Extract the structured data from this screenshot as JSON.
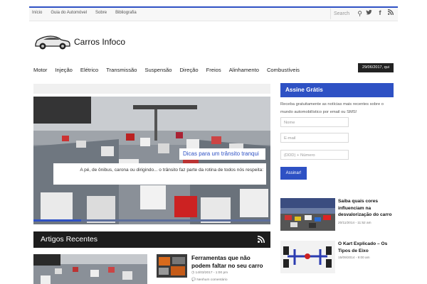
{
  "topnav": [
    "Início",
    "Guia do Automóvel",
    "Sobre",
    "Bibliografia"
  ],
  "search_placeholder": "Search",
  "site_title": "Carros Infoco",
  "mainnav": [
    "Motor",
    "Injeção",
    "Elétrico",
    "Transmissão",
    "Suspensão",
    "Direção",
    "Freios",
    "Alinhamento",
    "Combustíveis"
  ],
  "date_badge": "29/06/2017, qui",
  "slider": {
    "title": "Dicas para um trânsito tranqui",
    "text": "A pé, de ônibus, carona ou dirigindo... o trânsito faz parte da rotina de todos nós respeita:",
    "dot_colors": [
      "#2e51c4",
      "#5c6e9c",
      "#5c6e9c",
      "#5c6e9c",
      "#5c6e9c"
    ]
  },
  "artigos": {
    "header": "Artigos Recentes",
    "second": {
      "title": "Ferramentas que não podem faltar no seu carro",
      "date": "14/03/2017 - 1:00 pm",
      "comments": "Nenhum comentário"
    }
  },
  "sidebar": {
    "header": "Assine Grátis",
    "text": "Receba gratuitamente as notícias mais recentes sobre o mundo automobilístico por email ou SMS!",
    "nome_placeholder": "Nome",
    "email_placeholder": "E-mail",
    "phone_placeholder": "(DDD) + Número",
    "button": "Assinar!",
    "posts": [
      {
        "title": "Saiba quais cores influenciam na desvalorização do carro",
        "date": "20/11/2014 - 11:52 am"
      },
      {
        "title": "O Kart Explicado – Os Tipos de Eixo",
        "date": "15/09/2014 - 9:00 am"
      }
    ]
  },
  "colors": {
    "accent": "#2e51c4",
    "dark": "#1d1d1d"
  }
}
